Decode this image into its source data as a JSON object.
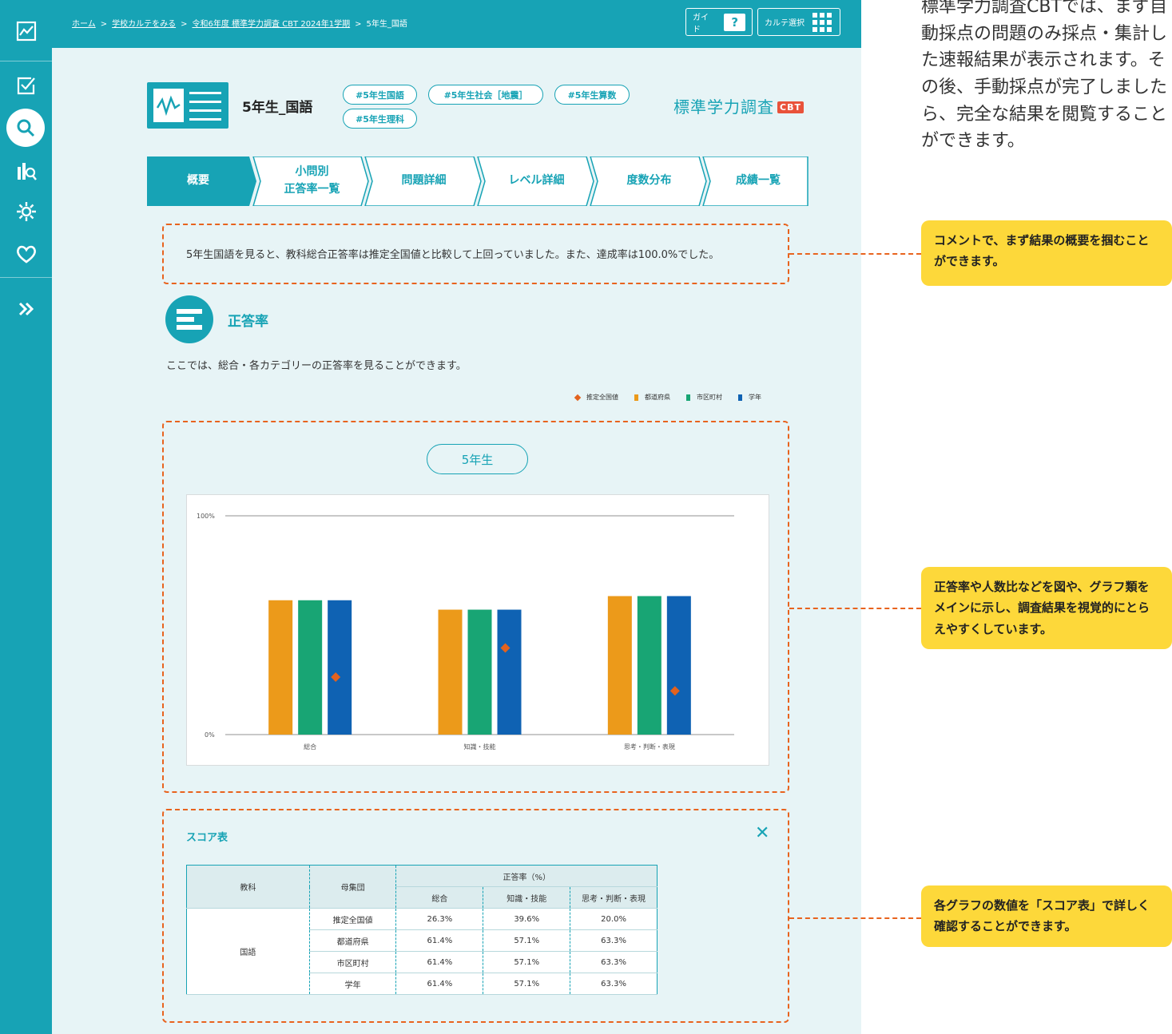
{
  "breadcrumb": {
    "items": [
      "ホーム",
      "学校カルテをみる",
      "令和6年度 標準学力調査 CBT 2024年1学期",
      "5年生_国語"
    ],
    "separator": ">"
  },
  "topbar": {
    "guide_label": "ガイド",
    "guide_icon": "?",
    "karte_label": "カルテ選択"
  },
  "header": {
    "title": "5年生_国語",
    "tags": [
      "#5年生国語",
      "#5年生社会［地震］",
      "#5年生算数",
      "#5年生理科"
    ],
    "brand": "標準学力調査",
    "brand_badge": "CBT"
  },
  "tabs": [
    {
      "label": "概要",
      "active": true
    },
    {
      "label": "小問別\n正答率一覧",
      "active": false
    },
    {
      "label": "問題詳細",
      "active": false
    },
    {
      "label": "レベル詳細",
      "active": false
    },
    {
      "label": "度数分布",
      "active": false
    },
    {
      "label": "成績一覧",
      "active": false
    }
  ],
  "comment": "5年生国語を見ると、教科総合正答率は推定全国値と比較して上回っていました。また、達成率は100.0%でした。",
  "section": {
    "title": "正答率",
    "description": "ここでは、総合・各カテゴリーの正答率を見ることができます。"
  },
  "legend": [
    {
      "name": "推定全国値",
      "color": "#e2621e",
      "shape": "diamond"
    },
    {
      "name": "都道府県",
      "color": "#ec9a1a",
      "shape": "bar"
    },
    {
      "name": "市区町村",
      "color": "#18a574",
      "shape": "bar"
    },
    {
      "name": "学年",
      "color": "#0f62b3",
      "shape": "bar"
    }
  ],
  "grade_pill": "5年生",
  "chart_data": {
    "type": "bar",
    "categories": [
      "総合",
      "知識・技能",
      "思考・判断・表現"
    ],
    "series": [
      {
        "name": "都道府県",
        "color": "#ec9a1a",
        "values": [
          61.4,
          57.1,
          63.3
        ]
      },
      {
        "name": "市区町村",
        "color": "#18a574",
        "values": [
          61.4,
          57.1,
          63.3
        ]
      },
      {
        "name": "学年",
        "color": "#0f62b3",
        "values": [
          61.4,
          57.1,
          63.3
        ]
      }
    ],
    "markers": {
      "name": "推定全国値",
      "color": "#e2621e",
      "values": [
        26.3,
        39.6,
        20.0
      ]
    },
    "ylim": [
      0,
      100
    ],
    "yticks": [
      "0%",
      "100%"
    ]
  },
  "score_table": {
    "title": "スコア表",
    "close_icon": "close-icon",
    "headers": {
      "subject": "教科",
      "group": "母集団",
      "rate": "正答率（%）",
      "cols": [
        "総合",
        "知識・技能",
        "思考・判断・表現"
      ]
    },
    "subject": "国語",
    "rows": [
      {
        "group": "推定全国値",
        "values": [
          "26.3%",
          "39.6%",
          "20.0%"
        ]
      },
      {
        "group": "都道府県",
        "values": [
          "61.4%",
          "57.1%",
          "63.3%"
        ]
      },
      {
        "group": "市区町村",
        "values": [
          "61.4%",
          "57.1%",
          "63.3%"
        ]
      },
      {
        "group": "学年",
        "values": [
          "61.4%",
          "57.1%",
          "63.3%"
        ]
      }
    ]
  },
  "annotations": {
    "intro": "標準学力調査CBTでは、まず自動採点の問題のみ採点・集計した速報結果が表示されます。その後、手動採点が完了しましたら、完全な結果を閲覧することができます。",
    "callouts": [
      "コメントで、まず結果の概要を掴むことができます。",
      "正答率や人数比などを図や、グラフ類をメインに示し、調査結果を視覚的にとらえやすくしています。",
      "各グラフの数値を「スコア表」で詳しく確認することができます。"
    ]
  }
}
